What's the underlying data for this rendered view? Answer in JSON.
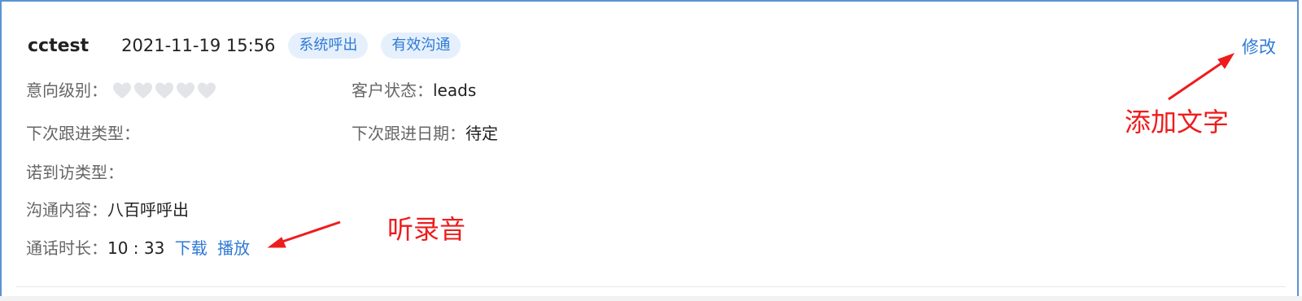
{
  "record": {
    "username": "cctest",
    "datetime": "2021-11-19 15:56",
    "tags": [
      "系统呼出",
      "有效沟通"
    ],
    "edit_label": "修改"
  },
  "fields": {
    "intent_label": "意向级别：",
    "intent_rating": 0,
    "intent_max": 5,
    "customer_status_label": "客户状态：",
    "customer_status_value": "leads",
    "next_followup_type_label": "下次跟进类型：",
    "next_followup_date_label": "下次跟进日期：",
    "next_followup_date_value": "待定",
    "promised_visit_type_label": "诺到访类型：",
    "communication_label": "沟通内容：",
    "communication_value": "八百呼呼出",
    "call_duration_label": "通话时长：",
    "call_duration_value": "10 : 33",
    "download_label": "下载",
    "play_label": "播放"
  },
  "annotations": {
    "edit_note": "添加文字",
    "play_note": "听录音",
    "color": "#ee1c1c"
  },
  "colors": {
    "accent": "#2f7ad6",
    "tag_bg": "#e6f0fc",
    "heart_empty": "#e2e4e8"
  }
}
